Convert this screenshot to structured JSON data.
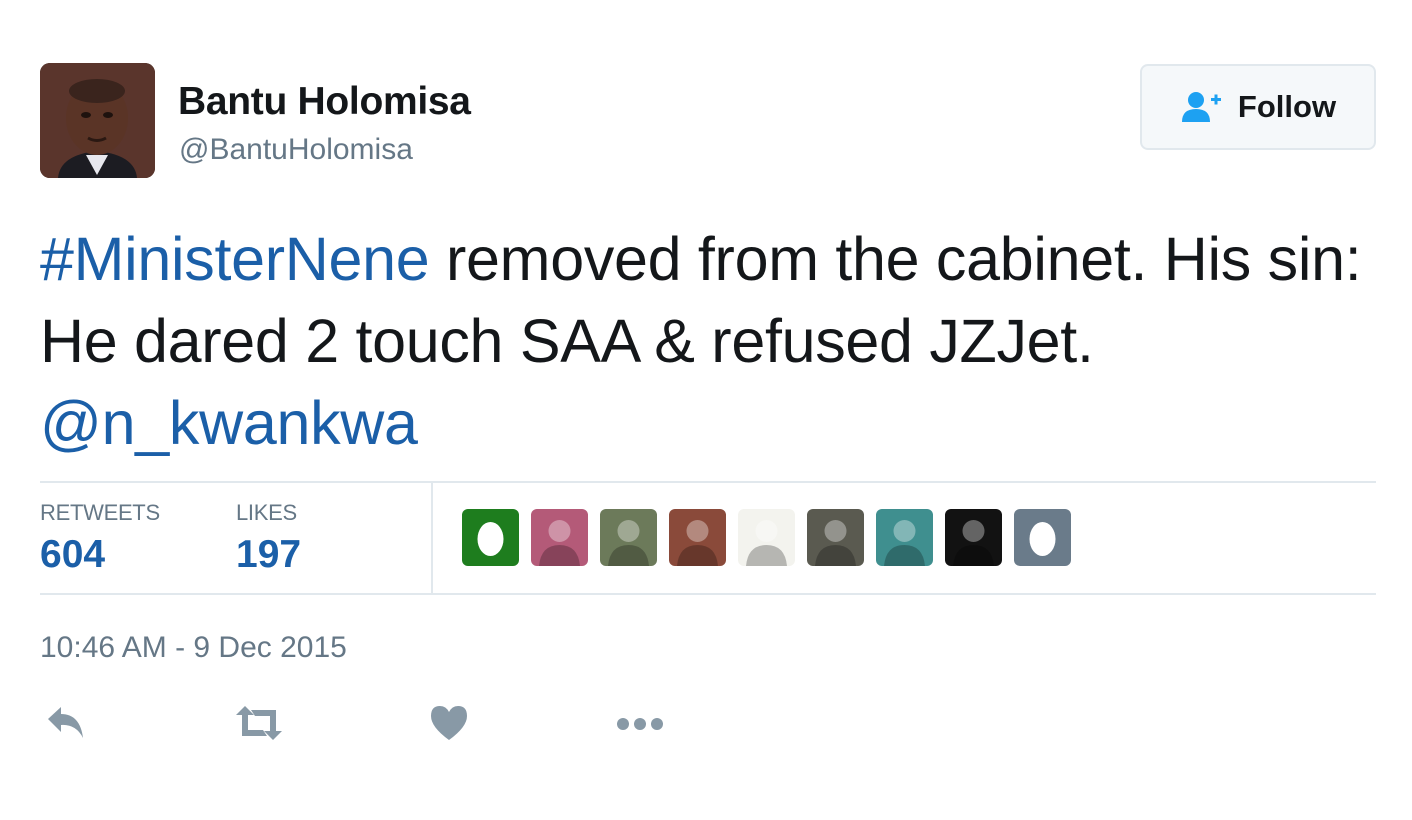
{
  "user": {
    "display_name": "Bantu Holomisa",
    "screen_name": "@BantuHolomisa",
    "avatar_icon": "profile-photo"
  },
  "follow_button": {
    "label": "Follow",
    "icon": "add-user-icon"
  },
  "tweet": {
    "hashtag": "#MinisterNene",
    "text_part1": " removed from the cabinet. His sin: He dared 2 touch SAA & refused JZJet. ",
    "mention": "@n_kwankwa"
  },
  "stats": {
    "retweets_label": "RETWEETS",
    "retweets_count": "604",
    "likes_label": "LIKES",
    "likes_count": "197"
  },
  "likers": [
    {
      "name": "liker-egg-green",
      "icon": "egg-avatar",
      "color": "#1e7d1e"
    },
    {
      "name": "liker-flowers",
      "icon": "photo-avatar",
      "color": "#b45a78"
    },
    {
      "name": "liker-person-1",
      "icon": "photo-avatar",
      "color": "#6c7a5a"
    },
    {
      "name": "liker-woman",
      "icon": "photo-avatar",
      "color": "#8a4a3a"
    },
    {
      "name": "liker-minion-ghost",
      "icon": "photo-avatar",
      "color": "#f3f3ee"
    },
    {
      "name": "liker-person-2",
      "icon": "photo-avatar",
      "color": "#5a5a50"
    },
    {
      "name": "liker-person-3",
      "icon": "photo-avatar",
      "color": "#3f8f8f"
    },
    {
      "name": "liker-person-4",
      "icon": "photo-avatar",
      "color": "#121212"
    },
    {
      "name": "liker-egg-grey",
      "icon": "egg-avatar",
      "color": "#6a7b8a"
    }
  ],
  "timestamp": "10:46 AM - 9 Dec 2015",
  "actions": [
    {
      "name": "reply-icon"
    },
    {
      "name": "retweet-icon"
    },
    {
      "name": "like-heart-icon"
    },
    {
      "name": "more-icon"
    }
  ],
  "colors": {
    "link": "#1b5fa8",
    "secondary_text": "#657786",
    "follow_icon": "#1da1f2",
    "action_icon": "#8899a6",
    "divider": "#e1e8ed"
  }
}
